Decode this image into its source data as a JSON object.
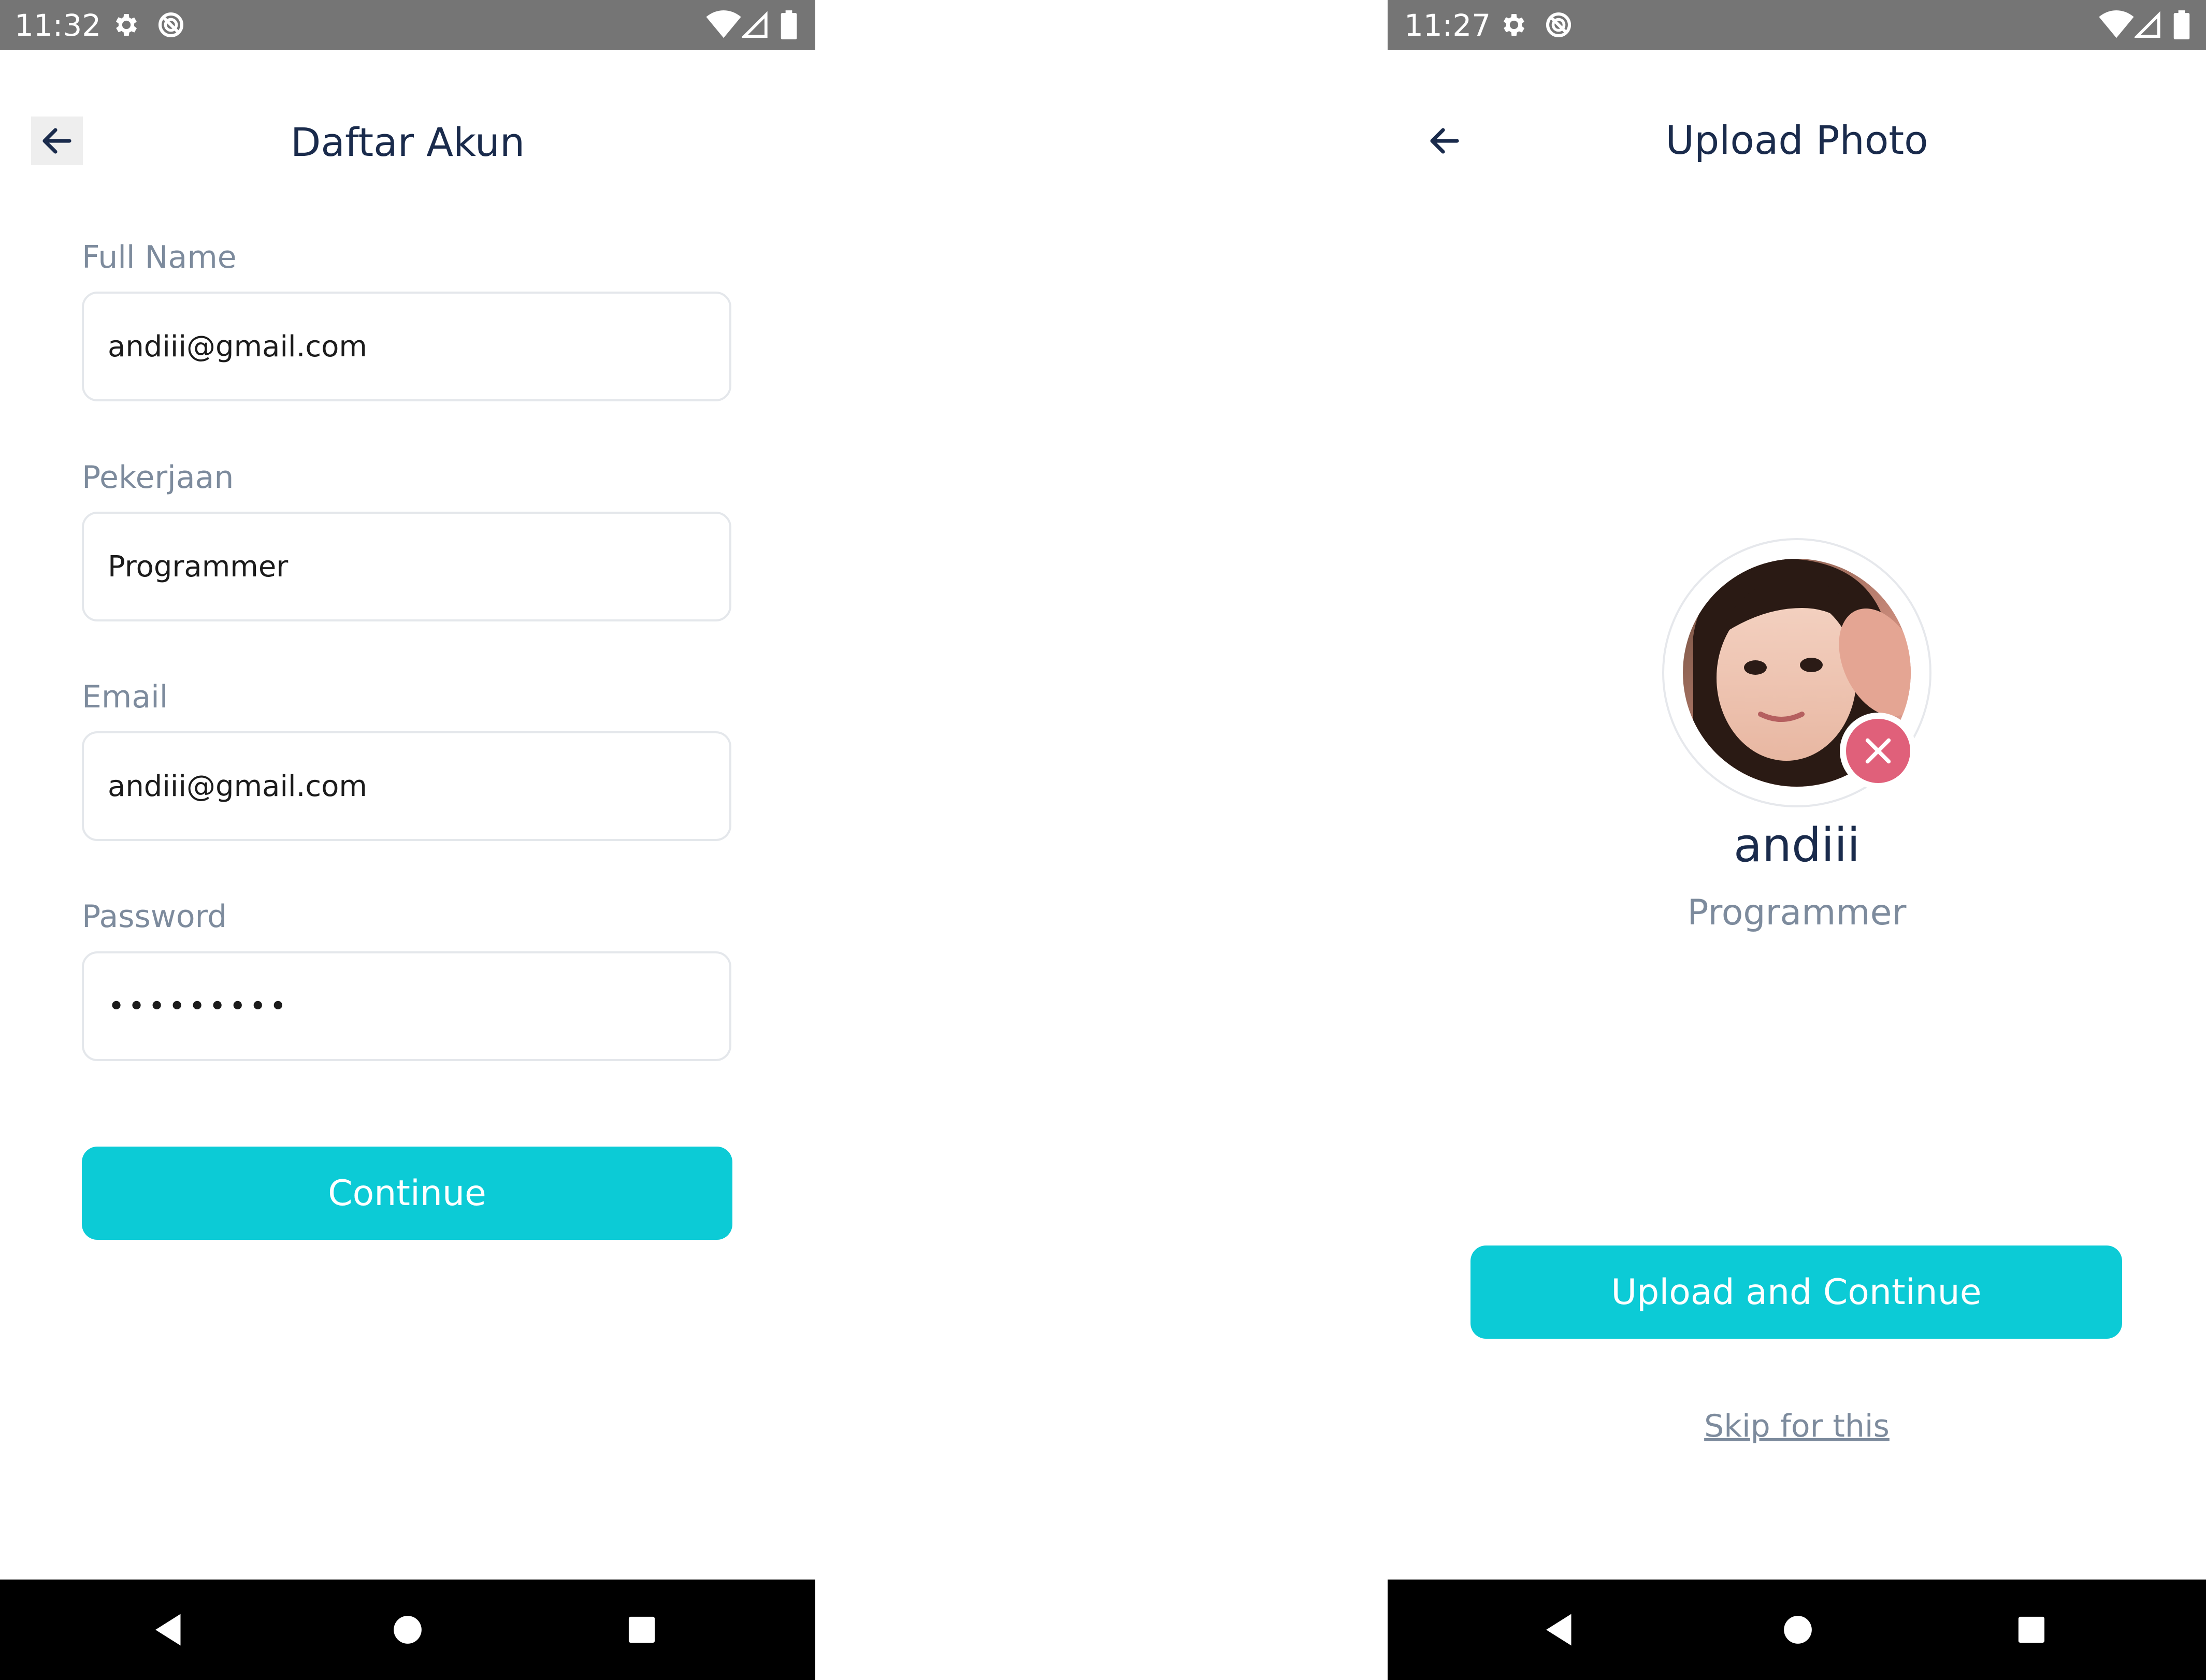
{
  "left_screen": {
    "status_bar": {
      "time": "11:32"
    },
    "header": {
      "title": "Daftar Akun"
    },
    "form": {
      "fields": [
        {
          "label": "Full Name",
          "value": "andiii@gmail.com"
        },
        {
          "label": "Pekerjaan",
          "value": "Programmer"
        },
        {
          "label": "Email",
          "value": "andiii@gmail.com"
        },
        {
          "label": "Password",
          "value": "•••••••••"
        }
      ],
      "continue_label": "Continue"
    }
  },
  "right_screen": {
    "status_bar": {
      "time": "11:27"
    },
    "header": {
      "title": "Upload Photo"
    },
    "profile": {
      "name": "andiii",
      "job": "Programmer"
    },
    "upload_label": "Upload and Continue",
    "skip_label": "Skip for this"
  },
  "icons": {
    "status": [
      "gear-icon",
      "no-entry-circle-icon",
      "wifi-icon",
      "signal-icon",
      "battery-icon"
    ],
    "navigation": [
      "back-triangle-icon",
      "home-circle-icon",
      "recents-square-icon"
    ],
    "header": "arrow-left-icon",
    "avatar_badge": "close-icon"
  },
  "colors": {
    "accent": "#0ccbd6",
    "title": "#1a2b4c",
    "muted": "#7d8b9d",
    "status_bar": "#757575",
    "nav_bar": "#000000",
    "remove_badge": "#e0607a"
  }
}
